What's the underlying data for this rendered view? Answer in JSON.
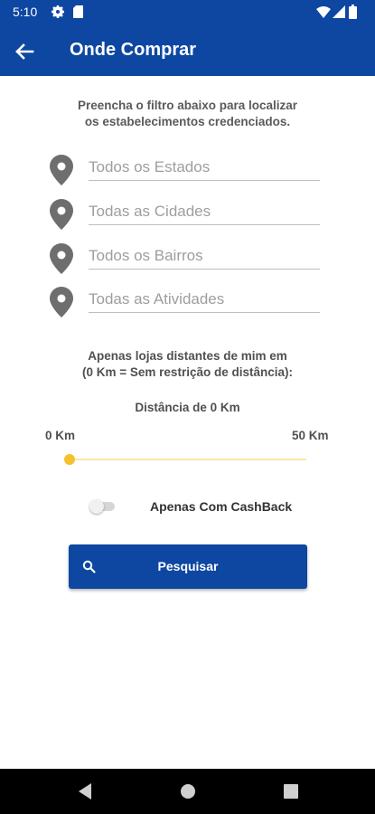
{
  "status_bar": {
    "time": "5:10"
  },
  "app_bar": {
    "title": "Onde Comprar"
  },
  "intro": {
    "line1": "Preencha o filtro abaixo para localizar",
    "line2": "os estabelecimentos credenciados."
  },
  "filters": {
    "estado_placeholder": "Todos os Estados",
    "cidade_placeholder": "Todas as Cidades",
    "bairro_placeholder": "Todos os Bairros",
    "atividade_placeholder": "Todas as Atividades"
  },
  "distance": {
    "line1": "Apenas lojas distantes de mim em",
    "line2": "(0 Km = Sem restrição de distância):",
    "current": "Distância de 0 Km",
    "min_label": "0 Km",
    "max_label": "50 Km",
    "value_fraction": 0
  },
  "cashback": {
    "label": "Apenas Com CashBack",
    "enabled": false
  },
  "search_button": {
    "label": "Pesquisar"
  },
  "colors": {
    "primary": "#0d47a1",
    "accent": "#f5c12c"
  }
}
